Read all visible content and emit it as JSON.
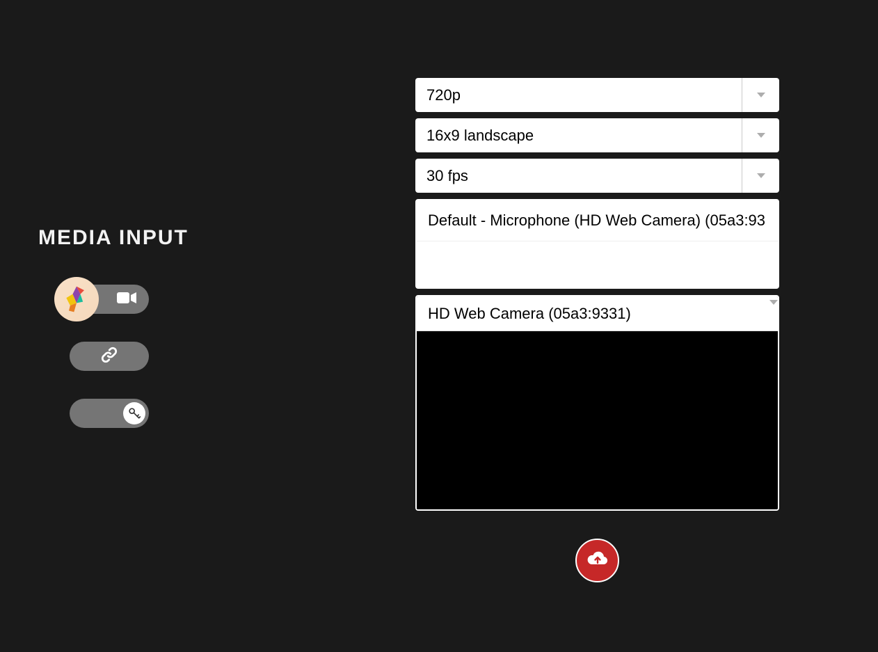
{
  "section_title": "MEDIA INPUT",
  "dropdowns": {
    "resolution": "720p",
    "aspect": "16x9 landscape",
    "fps": "30 fps"
  },
  "audio_device": "Default - Microphone (HD Web Camera) (05a3:93",
  "camera_device": "HD Web Camera (05a3:9331)"
}
